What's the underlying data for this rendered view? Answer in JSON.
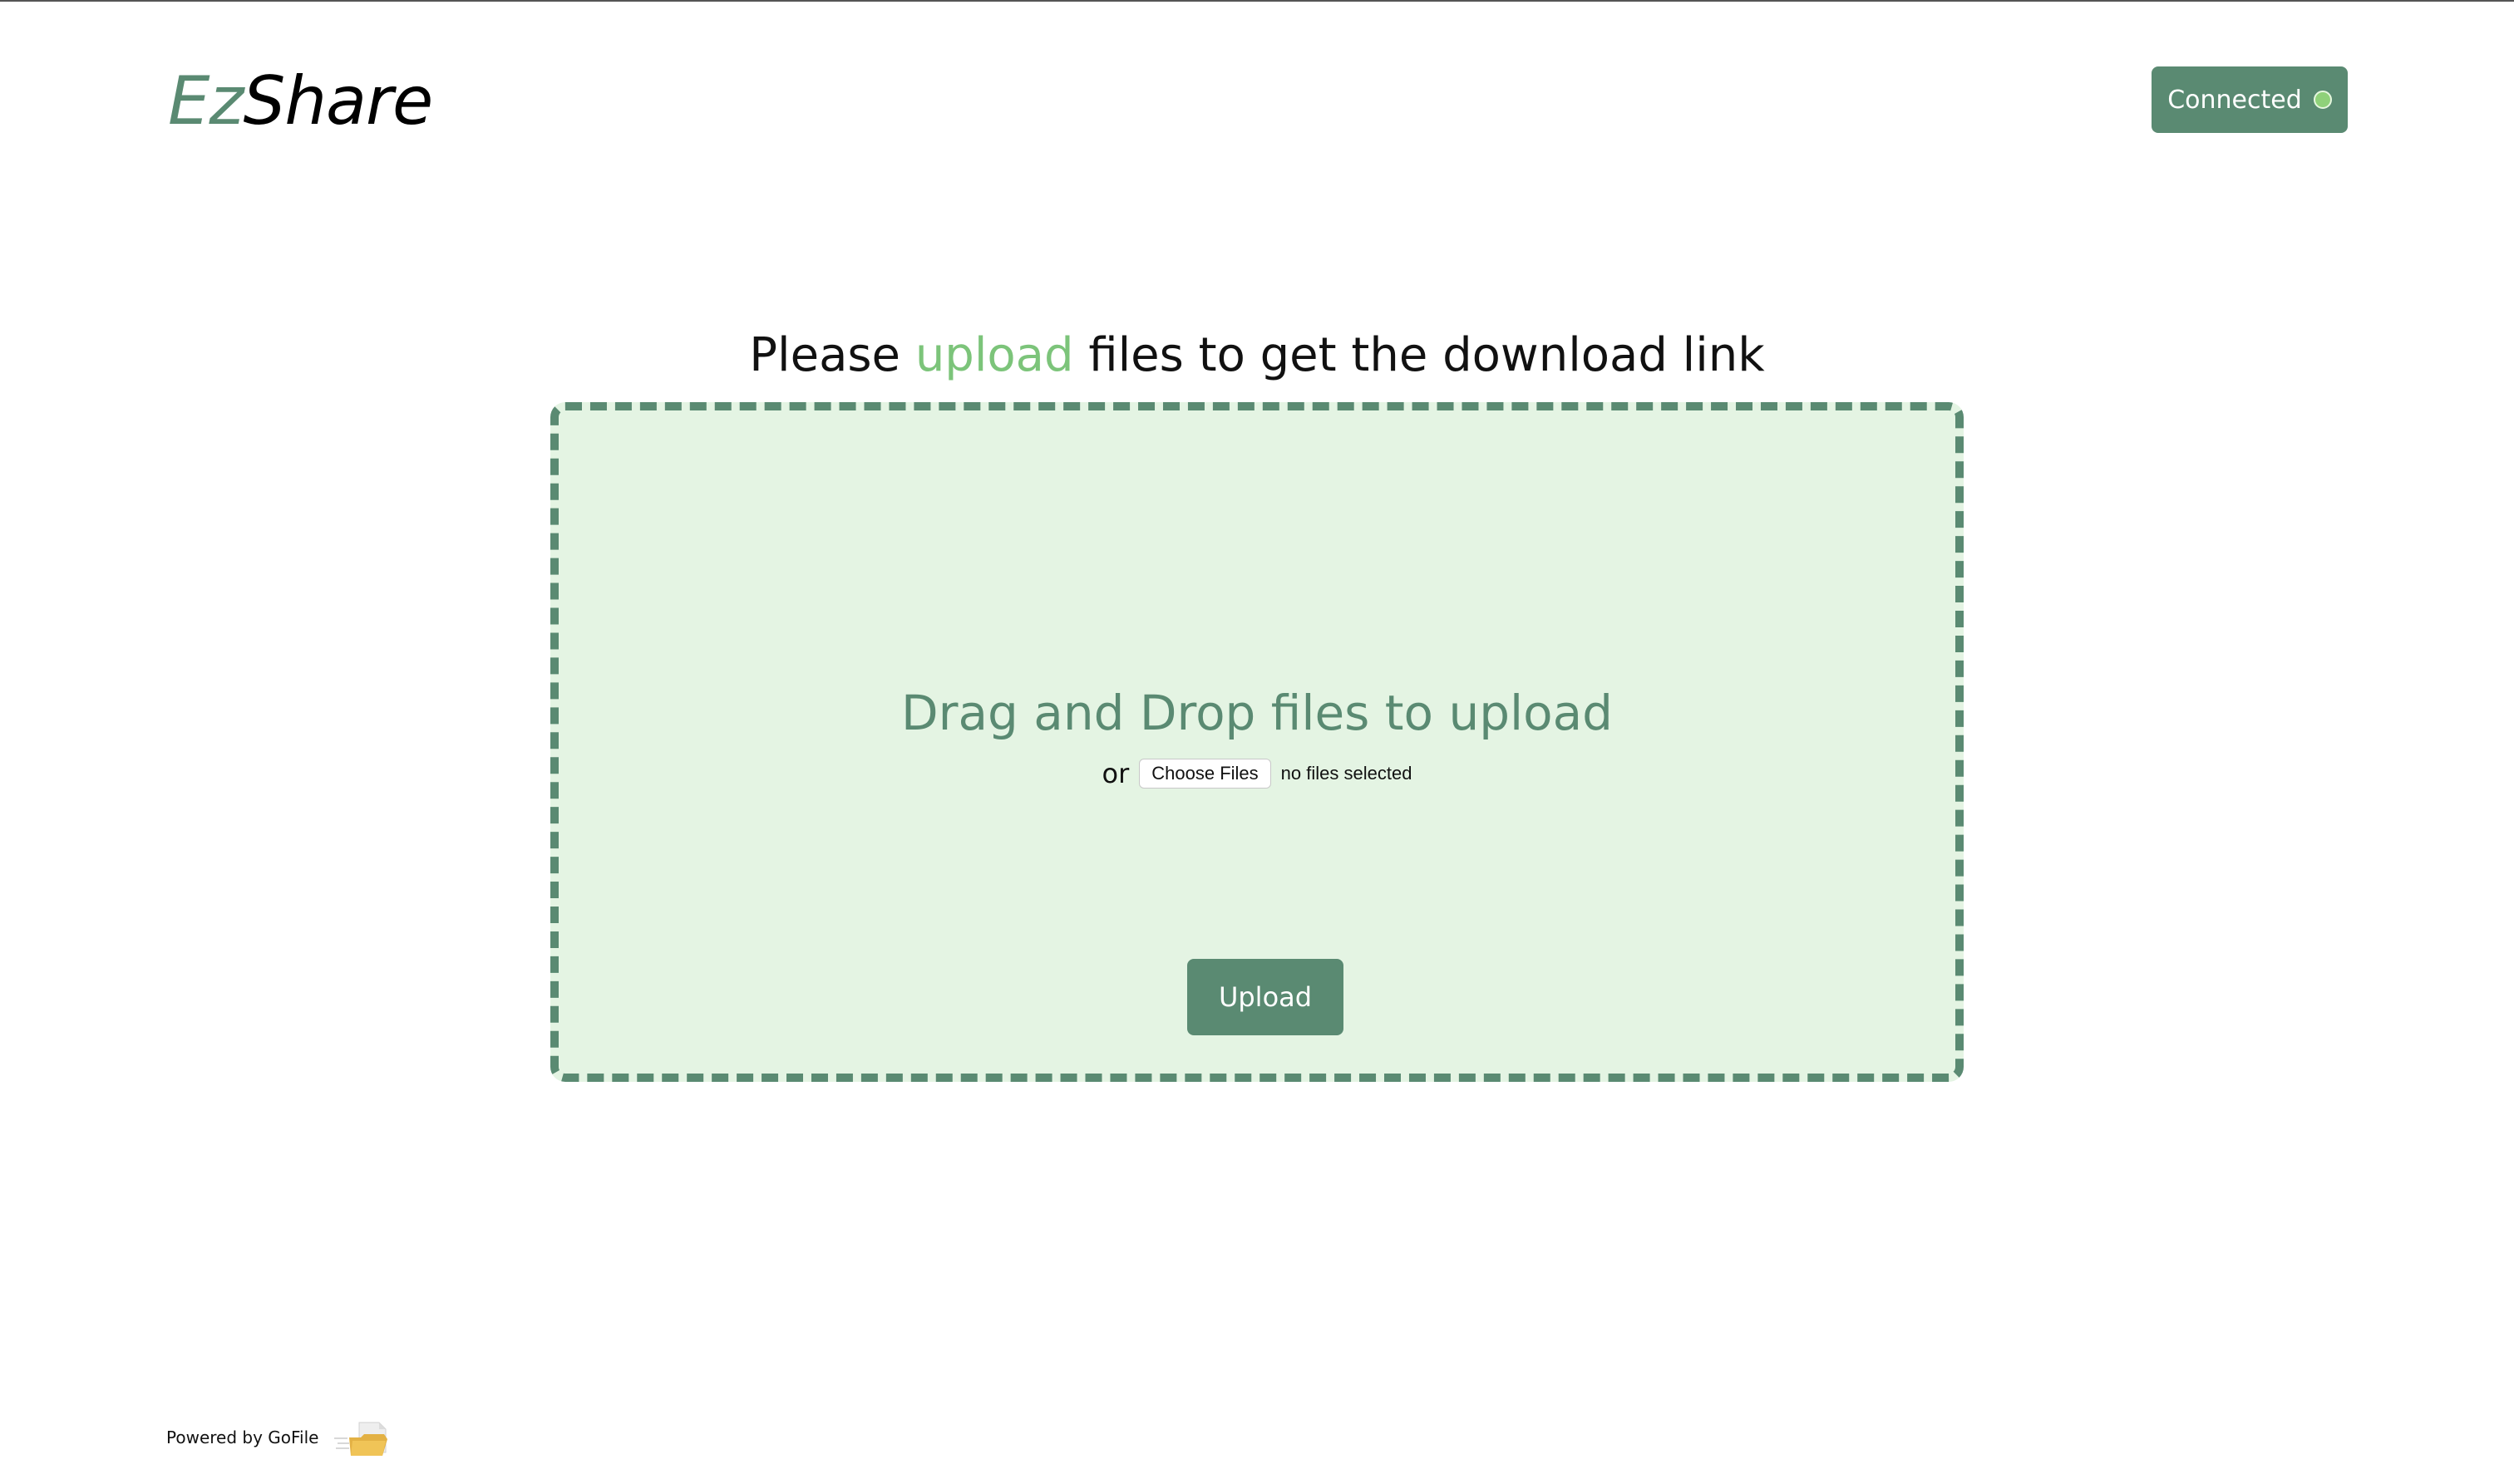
{
  "header": {
    "logo_part1": "Ez",
    "logo_part2": "Share",
    "status_label": "Connected",
    "status_icon": "status-dot-icon"
  },
  "heading": {
    "before": "Please ",
    "accent": "upload",
    "after": " files to get the download link"
  },
  "dropzone": {
    "title": "Drag and Drop files to upload",
    "or_text": "or",
    "choose_files_label": "Choose Files",
    "no_files_text": "no files selected",
    "upload_label": "Upload"
  },
  "footer": {
    "powered_text": "Powered by GoFile",
    "icon": "gofile-folder-icon"
  },
  "colors": {
    "brand_green": "#5a8a72",
    "accent_green": "#7cc47a",
    "dropzone_bg": "#e4f4e3",
    "status_dot": "#8fd17a"
  }
}
